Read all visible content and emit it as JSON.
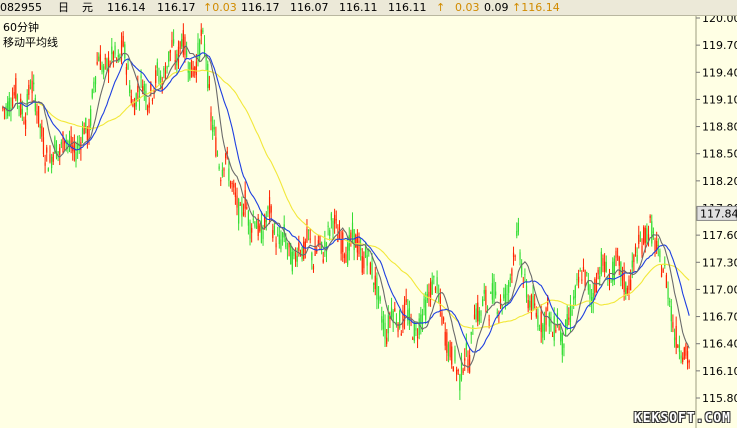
{
  "quote_bar": {
    "code": "082955",
    "unit_day": "日",
    "unit_currency": "元",
    "open": "116.14",
    "high": "116.17",
    "change_1": "↑0.03",
    "last_1": "116.17",
    "low": "116.07",
    "value_a": "116.11",
    "value_b": "116.11",
    "arrow": "↑",
    "change_2": "0.03",
    "percent": "0.09",
    "last_2": "↑116.14"
  },
  "indicator": {
    "period": "60分钟",
    "name": "移动平均线"
  },
  "watermark": "KEKSOFT.COM",
  "colors": {
    "background": "#FFFFE4",
    "up_candle": "#FF2200",
    "down_candle": "#33DD33",
    "ma_short": "#6B6B6B",
    "ma_mid": "#1E3FE0",
    "ma_long": "#F2E83A",
    "grid": "#C8C8A0",
    "current_price_bg": "#E0E0E0"
  },
  "chart_data": {
    "type": "candlestick",
    "title": "",
    "xlabel": "",
    "ylabel": "",
    "grid": true,
    "ylim": [
      115.8,
      120.0
    ],
    "y_ticks": [
      "120.00",
      "119.70",
      "119.40",
      "119.10",
      "118.80",
      "118.50",
      "118.20",
      "117.90",
      "117.60",
      "117.30",
      "117.00",
      "116.70",
      "116.40",
      "116.10",
      "115.80"
    ],
    "current_price": "117.84",
    "series": [
      {
        "name": "",
        "kind": "close_path",
        "values": [
          119.0,
          119.1,
          119.2,
          119.0,
          118.9,
          119.3,
          119.1,
          118.8,
          118.5,
          118.4,
          118.6,
          118.5,
          118.7,
          118.6,
          118.5,
          118.6,
          118.8,
          118.7,
          119.3,
          119.6,
          119.4,
          119.5,
          119.6,
          119.5,
          119.7,
          119.4,
          119.0,
          119.2,
          119.3,
          119.1,
          119.2,
          119.4,
          119.3,
          119.5,
          119.7,
          119.5,
          119.8,
          119.6,
          119.4,
          119.5,
          119.8,
          119.6,
          118.9,
          118.6,
          118.3,
          118.5,
          118.2,
          118.0,
          117.8,
          118.0,
          117.7,
          117.8,
          117.6,
          117.7,
          117.9,
          117.6,
          117.5,
          117.6,
          117.4,
          117.3,
          117.5,
          117.4,
          117.6,
          117.3,
          117.5,
          117.4,
          117.6,
          117.8,
          117.6,
          117.5,
          117.4,
          117.6,
          117.5,
          117.3,
          117.4,
          117.2,
          117.0,
          116.7,
          116.5,
          116.8,
          116.7,
          116.6,
          116.8,
          116.6,
          116.5,
          116.7,
          116.8,
          117.0,
          117.1,
          116.8,
          116.5,
          116.3,
          116.2,
          116.0,
          116.3,
          116.2,
          116.8,
          116.7,
          116.9,
          116.8,
          117.0,
          116.8,
          116.9,
          117.0,
          117.4,
          117.6,
          117.1,
          116.9,
          116.8,
          116.7,
          116.6,
          116.8,
          116.5,
          116.7,
          116.4,
          116.6,
          116.8,
          117.0,
          117.2,
          117.1,
          116.9,
          117.1,
          117.3,
          117.2,
          117.1,
          117.3,
          117.2,
          117.0,
          117.1,
          117.4,
          117.5,
          117.6,
          117.7,
          117.5,
          117.3,
          117.2,
          116.9,
          116.5,
          116.4,
          116.3,
          116.2
        ]
      }
    ]
  }
}
